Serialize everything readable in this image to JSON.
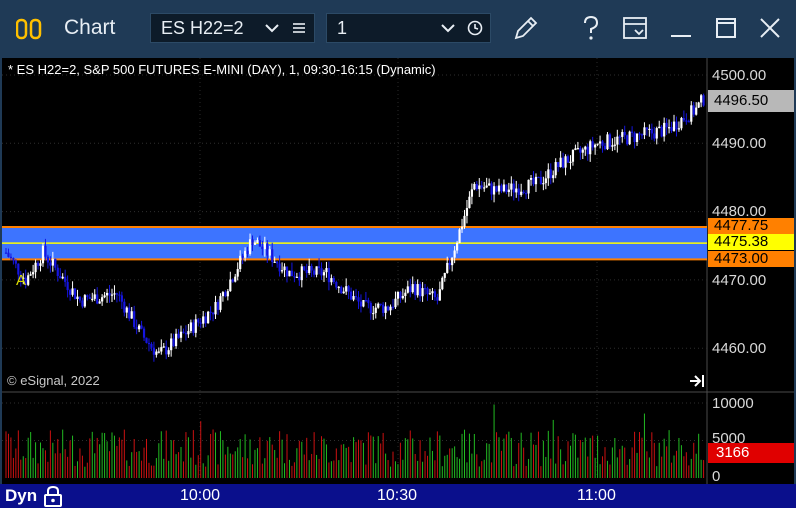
{
  "window": {
    "title": "Chart",
    "symbol_value": "ES H22=2",
    "interval_value": "1"
  },
  "chart": {
    "legend": "* ES H22=2, S&P 500 FUTURES E-MINI (DAY), 1, 09:30-16:15 (Dynamic)",
    "copyright": "© eSignal, 2022",
    "price_axis": [
      "4500.00",
      "4490.00",
      "4480.00",
      "4470.00",
      "4460.00"
    ],
    "last_price_tag": "4496.50",
    "band_upper_tag": "4477.75",
    "band_mid_tag": "4475.38",
    "band_lower_tag": "4473.00",
    "band_marker": "A",
    "volume_axis": [
      "10000",
      "5000",
      "0"
    ],
    "volume_tag": "3166",
    "time_axis": [
      "10:00",
      "10:30",
      "11:00"
    ],
    "mode_label": "Dyn"
  },
  "colors": {
    "titlebar": "#1f3a56",
    "up_candle": "#ffffff",
    "down_candle": "#1515e0",
    "band_fill": "#3d74ff",
    "band_edge": "#ff8000",
    "band_mid": "#ffff00",
    "volume_up": "#22bb22",
    "volume_down": "#cc1111",
    "time_bar": "#0a0f8c"
  },
  "chart_data": {
    "type": "candlestick",
    "ylim": [
      4455,
      4502
    ],
    "band": {
      "upper": 4477.75,
      "mid": 4475.38,
      "lower": 4473.0
    },
    "last_price": 4496.5,
    "volume_last": 3166,
    "volume_ylim": [
      0,
      10000
    ],
    "time_labels": [
      "10:00",
      "10:30",
      "11:00"
    ]
  }
}
